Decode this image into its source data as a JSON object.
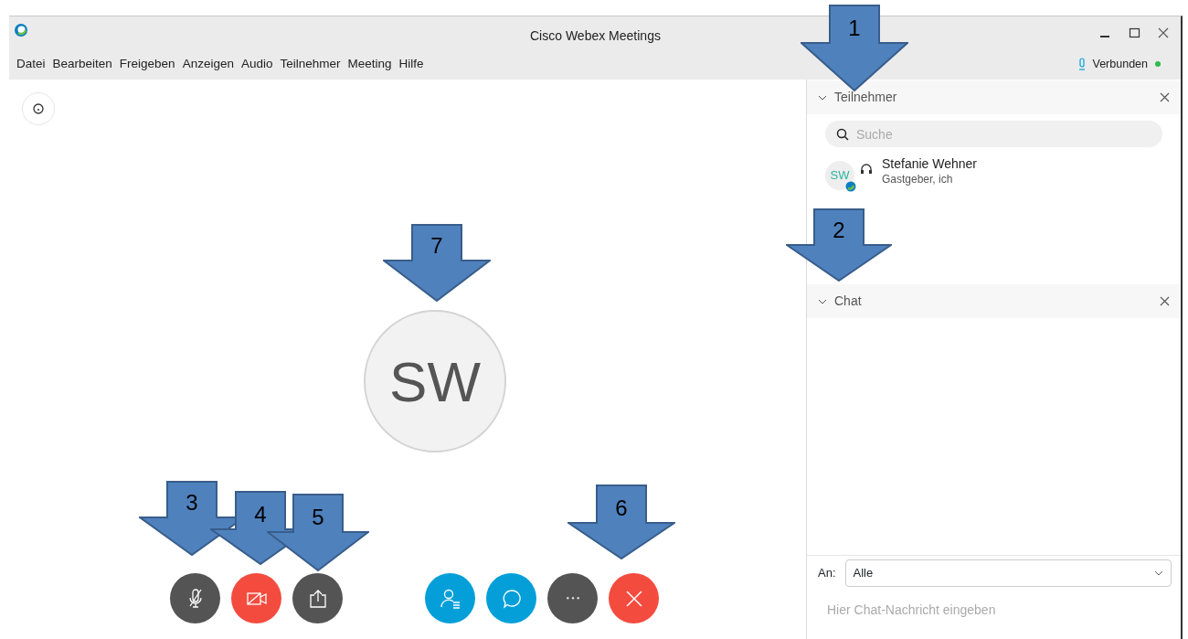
{
  "window": {
    "title": "Cisco Webex Meetings"
  },
  "menu": [
    {
      "label": "Datei"
    },
    {
      "label": "Bearbeiten"
    },
    {
      "label": "Freigeben"
    },
    {
      "label": "Anzeigen"
    },
    {
      "label": "Audio"
    },
    {
      "label": "Teilnehmer"
    },
    {
      "label": "Meeting"
    },
    {
      "label": "Hilfe"
    }
  ],
  "connection": {
    "label": "Verbunden",
    "color": "#2dbb4e"
  },
  "video": {
    "initials": "SW"
  },
  "controls": [
    {
      "kind": "mute",
      "color": "#545454"
    },
    {
      "kind": "video-off",
      "color": "#f44b3f"
    },
    {
      "kind": "share",
      "color": "#545454"
    },
    {
      "kind": "participants",
      "color": "#049fd9"
    },
    {
      "kind": "chat",
      "color": "#049fd9"
    },
    {
      "kind": "more",
      "color": "#545454"
    },
    {
      "kind": "end",
      "color": "#f44b3f"
    }
  ],
  "participants_panel": {
    "title": "Teilnehmer",
    "expanded": true,
    "search": {
      "placeholder": "Suche"
    },
    "people": [
      {
        "initials": "SW",
        "name": "Stefanie Wehner",
        "role": "Gastgeber, ich"
      }
    ]
  },
  "chat_panel": {
    "title": "Chat",
    "expanded": true,
    "to_label": "An:",
    "to_value": "Alle",
    "message": {
      "placeholder": "Hier Chat-Nachricht eingeben"
    }
  },
  "callouts": [
    {
      "label": "1"
    },
    {
      "label": "2"
    },
    {
      "label": "3"
    },
    {
      "label": "4"
    },
    {
      "label": "5"
    },
    {
      "label": "6"
    },
    {
      "label": "7"
    }
  ]
}
